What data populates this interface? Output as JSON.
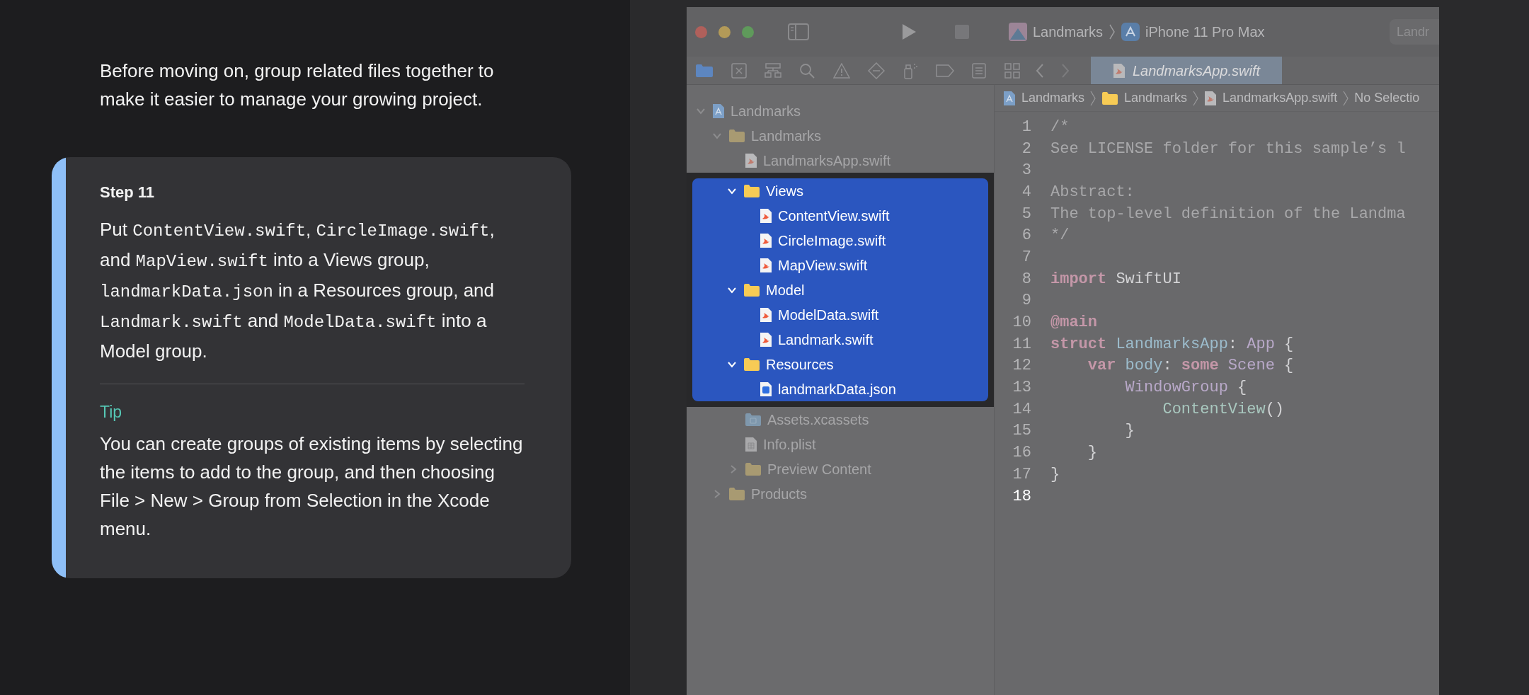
{
  "intro": "Before moving on, group related files together to make it easier to manage your growing project.",
  "step": {
    "label": "Step 11",
    "body": [
      {
        "text": "Put ",
        "code": false
      },
      {
        "text": "ContentView.swift",
        "code": true
      },
      {
        "text": ", ",
        "code": false
      },
      {
        "text": "CircleImage.swift",
        "code": true
      },
      {
        "text": ", and ",
        "code": false
      },
      {
        "text": "MapView.swift",
        "code": true
      },
      {
        "text": " into a Views group, ",
        "code": false
      },
      {
        "text": "landmarkData.json",
        "code": true
      },
      {
        "text": " in a Resources group, and ",
        "code": false
      },
      {
        "text": "Landmark.swift",
        "code": true
      },
      {
        "text": " and ",
        "code": false
      },
      {
        "text": "ModelData.swift",
        "code": true
      },
      {
        "text": " into a Model group.",
        "code": false
      }
    ],
    "tip_label": "Tip",
    "tip_text": "You can create groups of existing items by selecting the items to add to the group, and then choosing File > New > Group from Selection in the Xcode menu."
  },
  "xcode": {
    "scheme": "Landmarks",
    "device": "iPhone 11 Pro Max",
    "toolbar_field": "Landr",
    "editor_tab": {
      "label": "LandmarksApp.swift",
      "selected": true
    },
    "breadcrumb": [
      {
        "text": "Landmarks",
        "kind": "project"
      },
      {
        "text": "Landmarks",
        "kind": "folder"
      },
      {
        "text": "LandmarksApp.swift",
        "kind": "swift"
      },
      {
        "text": "No Selectio",
        "kind": "none"
      }
    ],
    "navigator": [
      {
        "label": "Landmarks",
        "kind": "project",
        "expanded": true,
        "selected": false,
        "children": [
          {
            "label": "Landmarks",
            "kind": "folder",
            "expanded": true,
            "selected": false,
            "children": [
              {
                "label": "LandmarksApp.swift",
                "kind": "swift",
                "selected": false
              },
              {
                "label": "Views",
                "kind": "folder",
                "expanded": true,
                "selected": true,
                "children": [
                  {
                    "label": "ContentView.swift",
                    "kind": "swift",
                    "selected": true
                  },
                  {
                    "label": "CircleImage.swift",
                    "kind": "swift",
                    "selected": true
                  },
                  {
                    "label": "MapView.swift",
                    "kind": "swift",
                    "selected": true
                  }
                ]
              },
              {
                "label": "Model",
                "kind": "folder",
                "expanded": true,
                "selected": true,
                "children": [
                  {
                    "label": "ModelData.swift",
                    "kind": "swift",
                    "selected": true
                  },
                  {
                    "label": "Landmark.swift",
                    "kind": "swift",
                    "selected": true
                  }
                ]
              },
              {
                "label": "Resources",
                "kind": "folder",
                "expanded": true,
                "selected": true,
                "children": [
                  {
                    "label": "landmarkData.json",
                    "kind": "json",
                    "selected": true
                  }
                ]
              },
              {
                "label": "Assets.xcassets",
                "kind": "assets",
                "selected": false
              },
              {
                "label": "Info.plist",
                "kind": "plist",
                "selected": false
              },
              {
                "label": "Preview Content",
                "kind": "folder",
                "expanded": false,
                "selected": false
              }
            ]
          },
          {
            "label": "Products",
            "kind": "folder",
            "expanded": false,
            "selected": false
          }
        ]
      }
    ],
    "code_lines": [
      {
        "number": "1",
        "current": false,
        "tokens": [
          {
            "text": "/*",
            "kind": "comment"
          }
        ]
      },
      {
        "number": "2",
        "current": false,
        "tokens": [
          {
            "text": "See LICENSE folder for this sample’s l",
            "kind": "comment"
          }
        ]
      },
      {
        "number": "3",
        "current": false
      },
      {
        "number": "4",
        "current": false,
        "tokens": [
          {
            "text": "Abstract:",
            "kind": "comment"
          }
        ]
      },
      {
        "number": "5",
        "current": false,
        "tokens": [
          {
            "text": "The top-level definition of the Landma",
            "kind": "comment"
          }
        ]
      },
      {
        "number": "6",
        "current": false,
        "tokens": [
          {
            "text": "*/",
            "kind": "comment"
          }
        ]
      },
      {
        "number": "7",
        "current": false
      },
      {
        "number": "8",
        "current": false,
        "tokens": [
          {
            "text": "import",
            "kind": "keyword"
          },
          {
            "text": " SwiftUI",
            "kind": "plain"
          }
        ]
      },
      {
        "number": "9",
        "current": false
      },
      {
        "number": "10",
        "current": false,
        "tokens": [
          {
            "text": "@main",
            "kind": "keyword"
          }
        ]
      },
      {
        "number": "11",
        "current": false,
        "tokens": [
          {
            "text": "struct",
            "kind": "keyword"
          },
          {
            "text": " LandmarksApp",
            "kind": "decl"
          },
          {
            "text": ": ",
            "kind": "plain"
          },
          {
            "text": "App",
            "kind": "type"
          },
          {
            "text": " {",
            "kind": "plain"
          }
        ]
      },
      {
        "number": "12",
        "current": false,
        "tokens": [
          {
            "text": "    var",
            "kind": "keyword"
          },
          {
            "text": " body",
            "kind": "decl"
          },
          {
            "text": ": ",
            "kind": "plain"
          },
          {
            "text": "some",
            "kind": "keyword"
          },
          {
            "text": " Scene",
            "kind": "type"
          },
          {
            "text": " {",
            "kind": "plain"
          }
        ]
      },
      {
        "number": "13",
        "current": false,
        "tokens": [
          {
            "text": "        WindowGroup",
            "kind": "type"
          },
          {
            "text": " {",
            "kind": "plain"
          }
        ]
      },
      {
        "number": "14",
        "current": false,
        "tokens": [
          {
            "text": "            ContentView",
            "kind": "call"
          },
          {
            "text": "()",
            "kind": "plain"
          }
        ]
      },
      {
        "number": "15",
        "current": false,
        "tokens": [
          {
            "text": "        }",
            "kind": "plain"
          }
        ]
      },
      {
        "number": "16",
        "current": false,
        "tokens": [
          {
            "text": "    }",
            "kind": "plain"
          }
        ]
      },
      {
        "number": "17",
        "current": false,
        "tokens": [
          {
            "text": "}",
            "kind": "plain"
          }
        ]
      },
      {
        "number": "18",
        "current": true
      }
    ]
  }
}
